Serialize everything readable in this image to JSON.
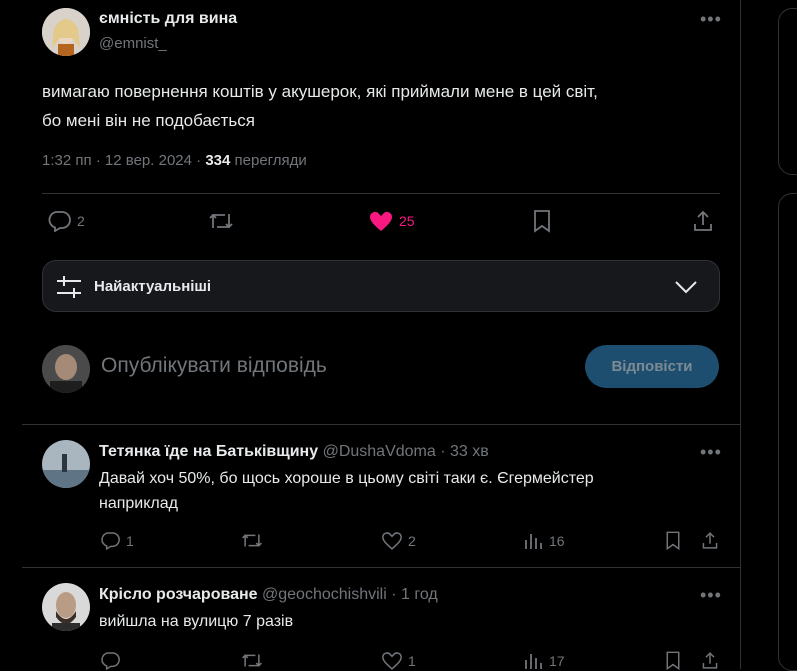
{
  "tweet": {
    "author_name": "ємність для вина",
    "author_handle": "@emnist_",
    "text_line1": "вимагаю повернення коштів у акушерок, які приймали мене в цей світ,",
    "text_line2": "бо мені він не подобається",
    "time": "1:32 пп · 12 вер. 2024 ·",
    "views_count": "334",
    "views_label": "перегляди",
    "replies": "2",
    "likes": "25"
  },
  "sort": {
    "label": "Найактуальніші"
  },
  "composer": {
    "placeholder": "Опублікувати відповідь",
    "reply_button": "Відповісти"
  },
  "replies": [
    {
      "name": "Тетянка їде на Батьківщину",
      "handle": "@DushaVdoma",
      "time": "· 33 хв",
      "text_line1": "Давай хоч 50%, бо щось хороше в цьому світі таки є. Єгермейстер",
      "text_line2": "наприклад",
      "replies": "1",
      "likes": "2",
      "views": "16"
    },
    {
      "name": "Крісло розчароване",
      "handle": "@geochochishvili",
      "time": "· 1 год",
      "text_line1": "вийшла на вулицю 7 разів",
      "replies": "",
      "likes": "1",
      "views": "17"
    }
  ],
  "colors": {
    "like_active": "#f91880",
    "accent_button": "#1d4e70",
    "muted": "#71767b"
  }
}
